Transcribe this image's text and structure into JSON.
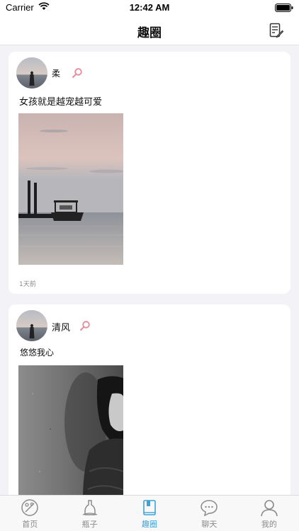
{
  "status_bar": {
    "carrier": "Carrier",
    "time": "12:42 AM"
  },
  "nav": {
    "title": "趣圈",
    "compose_icon": "compose-note-icon"
  },
  "posts": [
    {
      "username": "柔",
      "text": "女孩就是越宠越可爱",
      "timestamp": "1天前",
      "image": "sea-sunset-boat-photo"
    },
    {
      "username": "清风",
      "text": "悠悠我心",
      "image": "bw-woman-portrait-photo"
    }
  ],
  "tabs": [
    {
      "label": "首页",
      "icon": "home-palette-icon",
      "active": false
    },
    {
      "label": "瓶子",
      "icon": "bottle-icon",
      "active": false
    },
    {
      "label": "趣圈",
      "icon": "book-icon",
      "active": true
    },
    {
      "label": "聊天",
      "icon": "chat-bubble-icon",
      "active": false
    },
    {
      "label": "我的",
      "icon": "user-icon",
      "active": false
    }
  ],
  "colors": {
    "accent": "#3ba3d8",
    "inactive": "#8a8a8a",
    "background": "#f3f2f7",
    "search_icon": "#e88a9a"
  }
}
